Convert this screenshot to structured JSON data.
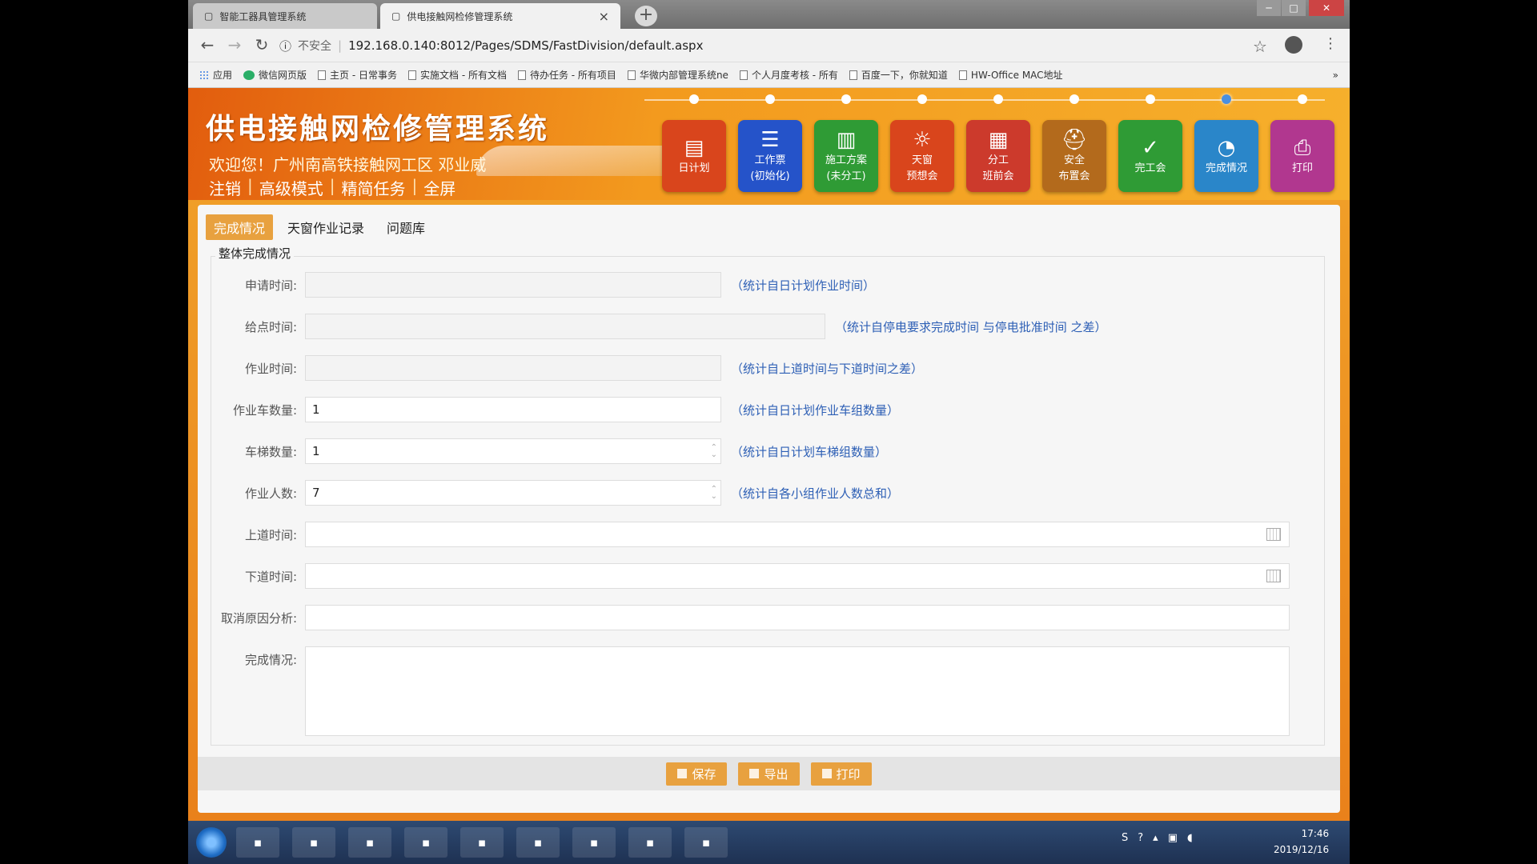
{
  "browser": {
    "tabs": [
      {
        "title": "智能工器具管理系统"
      },
      {
        "title": "供电接触网检修管理系统"
      }
    ],
    "address": {
      "security_label": "不安全",
      "url": "192.168.0.140:8012/Pages/SDMS/FastDivision/default.aspx"
    },
    "bookmarks": [
      {
        "label": "应用",
        "icon": "apps-grid-icon"
      },
      {
        "label": "微信网页版",
        "icon": "wechat-icon"
      },
      {
        "label": "主页 - 日常事务",
        "icon": "page-icon"
      },
      {
        "label": "实施文档 - 所有文档",
        "icon": "page-icon"
      },
      {
        "label": "待办任务 - 所有项目",
        "icon": "page-icon"
      },
      {
        "label": "华微内部管理系统ne",
        "icon": "page-icon"
      },
      {
        "label": "个人月度考核 - 所有",
        "icon": "page-icon"
      },
      {
        "label": "百度一下，你就知道",
        "icon": "baidu-icon"
      },
      {
        "label": "HW-Office MAC地址",
        "icon": "page-icon"
      }
    ]
  },
  "app": {
    "title": "供电接触网检修管理系统",
    "welcome": "欢迎您！广州南高铁接触网工区 邓业威",
    "quick_links": [
      "注销",
      "高级模式",
      "精简任务",
      "全屏"
    ],
    "modules": [
      {
        "line1": "日计划",
        "line2": "",
        "color": "#d9451c",
        "icon": "calendar-icon"
      },
      {
        "line1": "工作票",
        "line2": "(初始化)",
        "color": "#2553c9",
        "icon": "ticket-icon"
      },
      {
        "line1": "施工方案",
        "line2": "(未分工)",
        "color": "#2f9b35",
        "icon": "document-icon"
      },
      {
        "line1": "天窗",
        "line2": "预想会",
        "color": "#d9451c",
        "icon": "bulb-icon"
      },
      {
        "line1": "分工",
        "line2": "班前会",
        "color": "#cc3a2c",
        "icon": "board-icon"
      },
      {
        "line1": "安全",
        "line2": "布置会",
        "color": "#b36a1c",
        "icon": "helmet-icon"
      },
      {
        "line1": "完工会",
        "line2": "",
        "color": "#2f9b35",
        "icon": "check-icon"
      },
      {
        "line1": "完成情况",
        "line2": "",
        "color": "#2a86c9",
        "icon": "pie-icon"
      },
      {
        "line1": "打印",
        "line2": "",
        "color": "#b1378f",
        "icon": "printer-icon"
      }
    ],
    "timeline_active_index": 7,
    "tabs": [
      "完成情况",
      "天窗作业记录",
      "问题库"
    ],
    "active_tab": "完成情况",
    "form": {
      "legend": "整体完成情况",
      "fields": [
        {
          "label": "申请时间:",
          "value": "",
          "hint": "（统计自日计划作业时间）"
        },
        {
          "label": "给点时间:",
          "value": "",
          "hint": "（统计自停电要求完成时间 与停电批准时间 之差）"
        },
        {
          "label": "作业时间:",
          "value": "",
          "hint": "（统计自上道时间与下道时间之差）"
        },
        {
          "label": "作业车数量:",
          "value": "1",
          "hint": "（统计自日计划作业车组数量）"
        },
        {
          "label": "车梯数量:",
          "value": "1",
          "hint": "（统计自日计划车梯组数量）"
        },
        {
          "label": "作业人数:",
          "value": "7",
          "hint": "（统计自各小组作业人数总和）"
        },
        {
          "label": "上道时间:",
          "value": "",
          "hint": ""
        },
        {
          "label": "下道时间:",
          "value": "",
          "hint": ""
        },
        {
          "label": "取消原因分析:",
          "value": "",
          "hint": ""
        },
        {
          "label": "完成情况:",
          "value": "",
          "hint": ""
        }
      ]
    },
    "buttons": {
      "save": "保存",
      "export": "导出",
      "print": "打印"
    }
  },
  "taskbar": {
    "apps": [
      "outlook-icon",
      "app-icon",
      "explorer-icon",
      "chrome-icon",
      "notepad-icon",
      "media-icon",
      "photo-icon",
      "word-icon",
      "app-icon"
    ],
    "clock_time": "17:46",
    "clock_date": "2019/12/16"
  }
}
